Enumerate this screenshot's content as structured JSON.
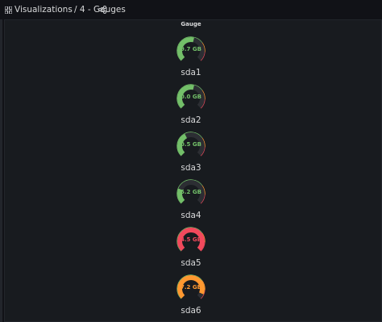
{
  "header": {
    "breadcrumb_root": "Visualizations",
    "breadcrumb_current": "/ 4 - Gauges",
    "grid_icon": "apps-grid-icon",
    "share_icon": "share-icon"
  },
  "panel": {
    "title": "Gauge",
    "gauges": [
      {
        "label": "sda1",
        "value_text": "9.7 GB",
        "fill": 0.55,
        "color": "#73bf69"
      },
      {
        "label": "sda2",
        "value_text": "0.0 GB",
        "fill": 0.55,
        "color": "#73bf69"
      },
      {
        "label": "sda3",
        "value_text": "0.5 GB",
        "fill": 0.4,
        "color": "#73bf69"
      },
      {
        "label": "sda4",
        "value_text": "5.2 GB",
        "fill": 0.25,
        "color": "#73bf69"
      },
      {
        "label": "sda5",
        "value_text": "4.5 GB",
        "fill": 1.0,
        "color": "#f2495c"
      },
      {
        "label": "sda6",
        "value_text": "7.2 GB",
        "fill": 0.92,
        "color": "#ff9830"
      }
    ],
    "threshold_colors": {
      "ok": "#73bf69",
      "warn": "#ff9830",
      "critical": "#f2495c"
    }
  }
}
